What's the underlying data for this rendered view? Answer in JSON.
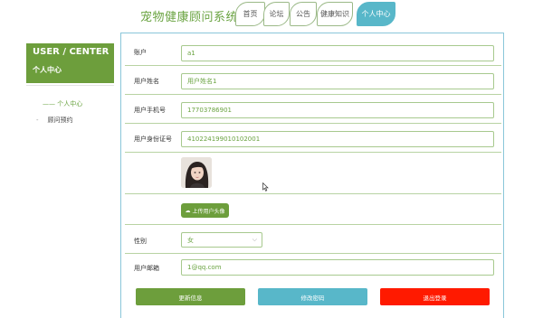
{
  "header": {
    "site_title": "宠物健康顾问系统",
    "nav": [
      {
        "label": "首页"
      },
      {
        "label": "论坛"
      },
      {
        "label": "公告"
      },
      {
        "label": "健康知识"
      },
      {
        "label": "个人中心",
        "active": true
      }
    ]
  },
  "sidebar": {
    "title_en": "USER / CENTER",
    "title_cn": "个人中心",
    "items": [
      {
        "label": "—— 个人中心",
        "active": true
      },
      {
        "label": "顾问预约",
        "active": false
      }
    ]
  },
  "form": {
    "account": {
      "label": "账户",
      "value": "a1"
    },
    "name": {
      "label": "用户姓名",
      "value": "用户姓名1"
    },
    "phone": {
      "label": "用户手机号",
      "value": "17703786901"
    },
    "id_card": {
      "label": "用户身份证号",
      "value": "410224199010102001"
    },
    "avatar_icon": "user-photo",
    "upload_label": "上传用户头像",
    "upload_icon": "cloud-upload-icon",
    "gender": {
      "label": "性别",
      "value": "女"
    },
    "email": {
      "label": "用户邮箱",
      "value": "1@qq.com"
    }
  },
  "actions": {
    "update_label": "更新信息",
    "change_password_label": "修改密码",
    "logout_label": "退出登录"
  },
  "colors": {
    "green": "#6d9e3c",
    "teal": "#58b7c9",
    "red": "#ff1a00",
    "title_green": "#6aa341"
  }
}
